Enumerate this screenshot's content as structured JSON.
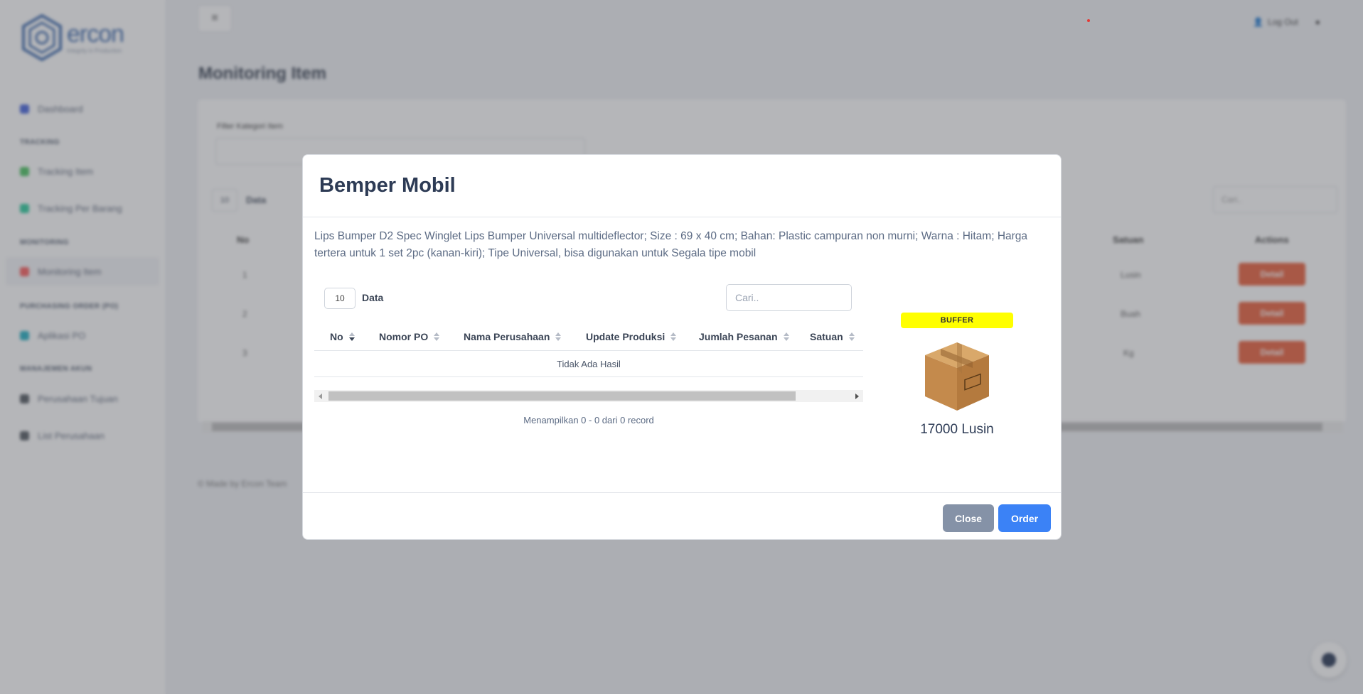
{
  "background": {
    "logo": {
      "name": "ercon",
      "tagline": "Integrity in Production"
    },
    "sidebar": {
      "items": [
        {
          "label": "Dashboard",
          "color": "#3b5bdb"
        },
        {
          "label": "Tracking Item",
          "color": "#40c057"
        },
        {
          "label": "Tracking Per Barang",
          "color": "#20c997"
        },
        {
          "label": "Monitoring Item",
          "color": "#fa5252"
        },
        {
          "label": "Aplikasi PO",
          "color": "#15aabf"
        },
        {
          "label": "Perusahaan Tujuan",
          "color": "#495057"
        },
        {
          "label": "List Perusahaan",
          "color": "#495057"
        }
      ],
      "sections": [
        "TRACKING",
        "MONITORING",
        "PURCHASING ORDER (PO)",
        "MANAJEMEN AKUN"
      ]
    },
    "topbar": {
      "logout": "Log Out"
    },
    "page_title": "Monitoring Item",
    "filter_label": "Filter Kategori Item",
    "length_value": "10",
    "length_label": "Data",
    "search_placeholder": "Cari..",
    "columns": {
      "no": "No",
      "satuan": "Satuan",
      "actions": "Actions"
    },
    "rows": [
      {
        "no": "1",
        "satuan": "Lusin",
        "action": "Detail"
      },
      {
        "no": "2",
        "satuan": "Buah",
        "action": "Detail"
      },
      {
        "no": "3",
        "satuan": "Kg",
        "action": "Detail"
      }
    ],
    "footer": "© Made by Ercon Team"
  },
  "modal": {
    "title": "Bemper Mobil",
    "description": "Lips Bumper D2 Spec Winglet Lips Bumper Universal multideflector; Size : 69 x 40 cm; Bahan: Plastic campuran non murni; Warna : Hitam; Harga tertera untuk 1 set 2pc (kanan-kiri); Tipe Universal, bisa digunakan untuk Segala tipe mobil",
    "table": {
      "length_value": "10",
      "length_label": "Data",
      "search_placeholder": "Cari..",
      "columns": [
        "No",
        "Nomor PO",
        "Nama Perusahaan",
        "Update Produksi",
        "Jumlah Pesanan",
        "Satuan"
      ],
      "empty_text": "Tidak Ada Hasil",
      "info": "Menampilkan 0 - 0 dari 0 record"
    },
    "stock": {
      "badge": "BUFFER",
      "badge_color": "#ffff00",
      "icon": "cardboard-box-icon",
      "quantity": "17000 Lusin"
    },
    "buttons": {
      "close": "Close",
      "order": "Order"
    }
  }
}
